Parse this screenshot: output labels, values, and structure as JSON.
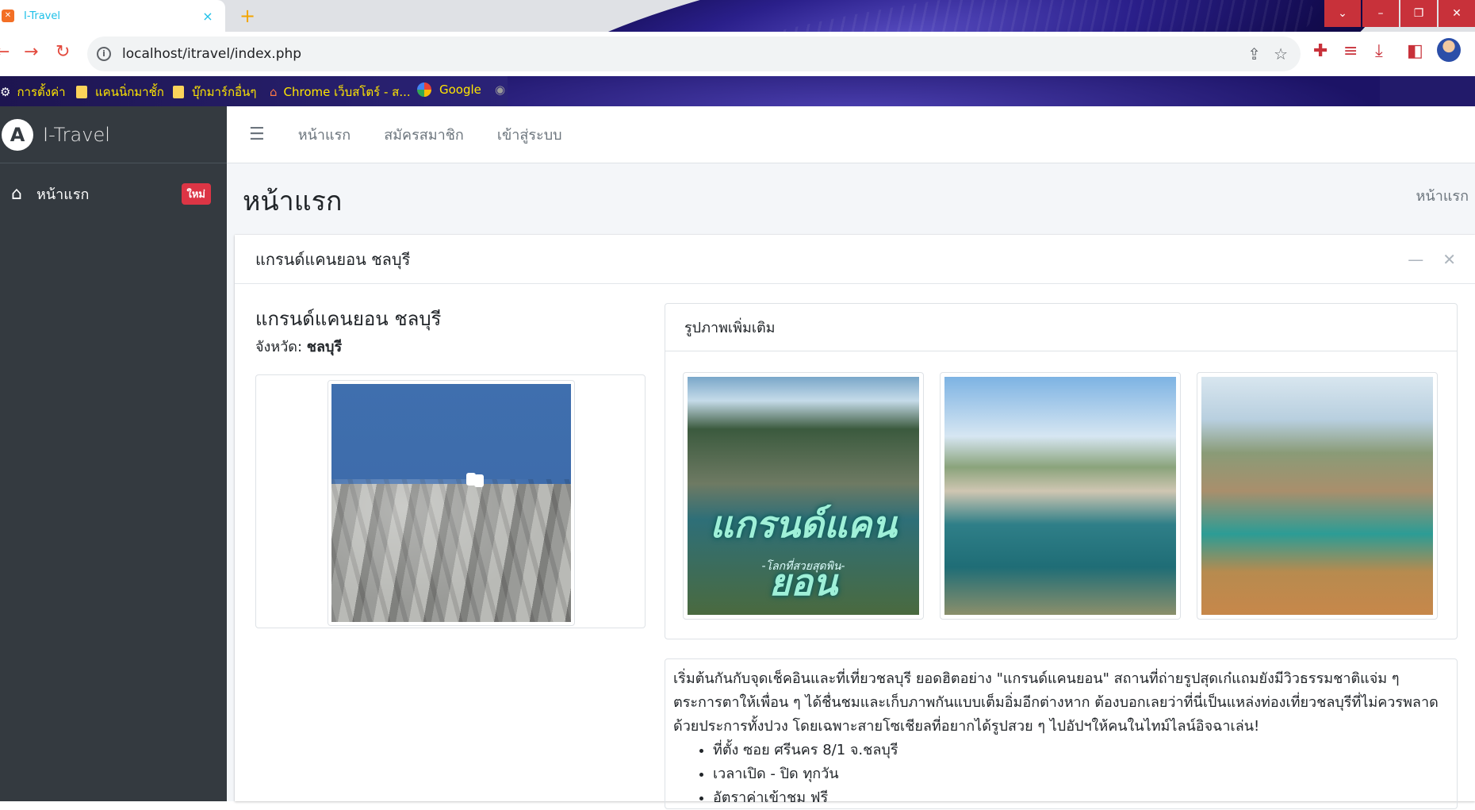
{
  "browser": {
    "tab_title": "I-Travel",
    "tab_close": "×",
    "new_tab": "+",
    "url": "localhost/itravel/index.php",
    "window_buttons": [
      "⌄",
      "–",
      "❐",
      "✕"
    ],
    "bookmarks": [
      {
        "label": "การตั้งค่า",
        "icon": "gear-icon"
      },
      {
        "label": "แคนนิ่กมาชั้ก",
        "icon": "folder-icon"
      },
      {
        "label": "บุ๊กมาร์กอื่นๆ",
        "icon": "folder-icon"
      },
      {
        "label": "Chrome เว็บสโตร์ - ส...",
        "icon": "chrome-store-icon"
      },
      {
        "label": "Google",
        "icon": "google-icon"
      }
    ]
  },
  "sidebar": {
    "brand": "I-Travel",
    "brand_logo": "A",
    "items": [
      {
        "label": "หน้าแรก",
        "icon": "home-icon",
        "badge": "ใหม่"
      }
    ]
  },
  "navbar": {
    "links": [
      "หน้าแรก",
      "สมัครสมาชิก",
      "เข้าสู่ระบบ"
    ]
  },
  "page": {
    "title": "หน้าแรก",
    "breadcrumb": "หน้าแรก"
  },
  "card": {
    "title": "แกรนด์แคนยอน ชลบุรี",
    "tool_minimize": "—",
    "tool_close": "✕",
    "place_name": "แกรนด์แคนยอน ชลบุรี",
    "province_label": "จังหวัด:",
    "province_value": "ชลบุรี",
    "gallery_title": "รูปภาพเพิ่มเติม",
    "thumb1_text": "แกรนด์แคนยอน",
    "thumb1_sub": "-โลกที่สวยสุดพิน-",
    "description": "เริ่มต้นกันกับจุดเช็คอินและที่เที่ยวชลบุรี ยอดฮิตอย่าง \"แกรนด์แคนยอน\" สถานที่ถ่ายรูปสุดเก๋แถมยังมีวิวธรรมชาติแจ่ม ๆ ตระการตาให้เพื่อน ๆ ได้ชื่นชมและเก็บภาพกันแบบเต็มอิ่มอีกต่างหาก ต้องบอกเลยว่าที่นี่เป็นแหล่งท่องเที่ยวชลบุรีที่ไม่ควรพลาดด้วยประการทั้งปวง โดยเฉพาะสายโซเชียลที่อยากได้รูปสวย ๆ ไปอัปฯให้คนในไทม์ไลน์อิจฉาเล่น!",
    "details": [
      "ที่ตั้ง ซอย ศรีนคร 8/1 จ.ชลบุรี",
      "เวลาเปิด - ปิด ทุกวัน",
      "อัตราค่าเข้าชม ฟรี"
    ]
  }
}
